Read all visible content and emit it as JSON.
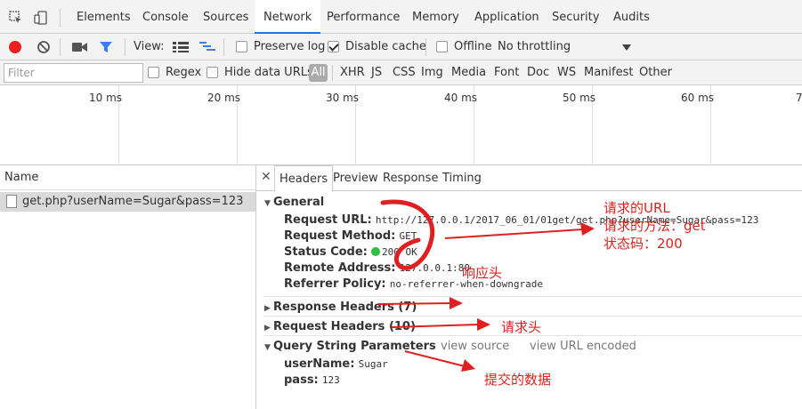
{
  "tabs": [
    "Elements",
    "Console",
    "Sources",
    "Network",
    "Performance",
    "Memory",
    "Application",
    "Security",
    "Audits"
  ],
  "active_tab": "Network",
  "toolbar": {
    "view_label": "View:",
    "preserve_log": "Preserve log",
    "preserve_log_checked": false,
    "disable_cache": "Disable cache",
    "disable_cache_checked": true,
    "offline": "Offline",
    "offline_checked": false,
    "throttling": "No throttling"
  },
  "filterbar": {
    "filter_placeholder": "Filter",
    "regex": "Regex",
    "hide_data_urls": "Hide data URLs",
    "all": "All",
    "types": [
      "XHR",
      "JS",
      "CSS",
      "Img",
      "Media",
      "Font",
      "Doc",
      "WS",
      "Manifest",
      "Other"
    ]
  },
  "timeline": {
    "ticks": [
      "10 ms",
      "20 ms",
      "30 ms",
      "40 ms",
      "50 ms",
      "60 ms",
      "7"
    ]
  },
  "request_list": {
    "header": "Name",
    "rows": [
      "get.php?userName=Sugar&pass=123"
    ]
  },
  "detail": {
    "tabs": [
      "Headers",
      "Preview",
      "Response",
      "Timing"
    ],
    "active_tab": "Headers",
    "general": {
      "title": "General",
      "request_url_label": "Request URL:",
      "request_url": "http://127.0.0.1/2017_06_01/01get/get.php?userName=Sugar&pass=123",
      "request_method_label": "Request Method:",
      "request_method": "GET",
      "status_code_label": "Status Code:",
      "status_code": "200 OK",
      "remote_address_label": "Remote Address:",
      "remote_address": "127.0.0.1:80",
      "referrer_policy_label": "Referrer Policy:",
      "referrer_policy": "no-referrer-when-downgrade"
    },
    "response_headers": "Response Headers (7)",
    "request_headers": "Request Headers (10)",
    "query_string": {
      "title": "Query String Parameters",
      "view_source": "view source",
      "view_url_encoded": "view URL encoded",
      "params": [
        {
          "key": "userName:",
          "value": "Sugar"
        },
        {
          "key": "pass:",
          "value": "123"
        }
      ]
    }
  },
  "annotations": {
    "request_url": "请求的URL",
    "request_method": "请求的方法：get",
    "status_code": "状态码：200",
    "response_headers": "响应头",
    "request_headers": "请求头",
    "submitted_data": "提交的数据"
  },
  "colors": {
    "record": "#e8201e",
    "accent": "#1a73e8",
    "status_ok": "#2dbf3d",
    "annotation": "#e02020"
  }
}
